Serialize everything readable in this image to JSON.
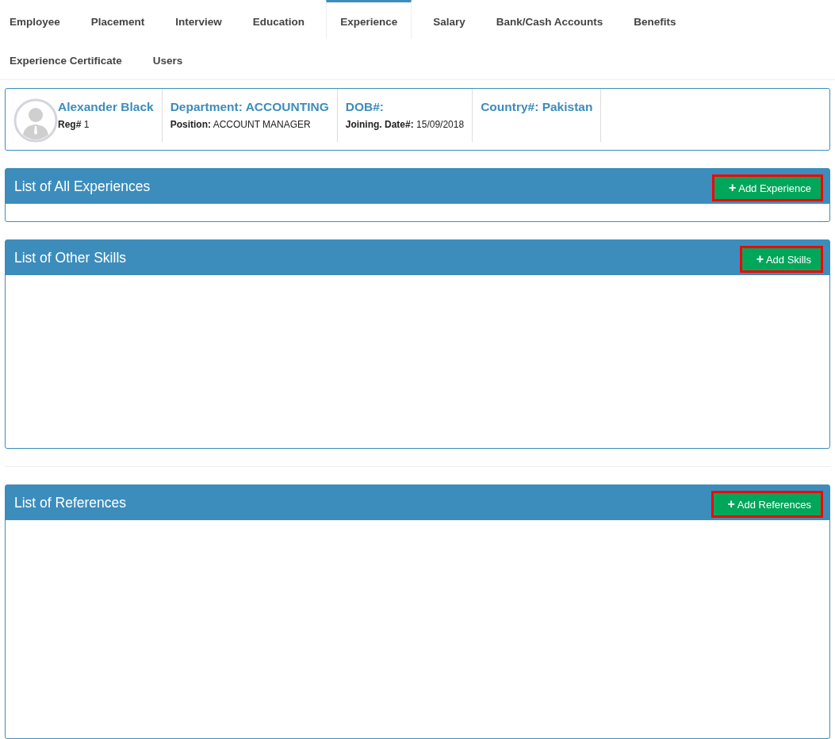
{
  "tabs": [
    {
      "label": "Employee",
      "selected": false
    },
    {
      "label": "Placement",
      "selected": false
    },
    {
      "label": "Interview",
      "selected": false
    },
    {
      "label": "Education",
      "selected": false
    },
    {
      "label": "Experience",
      "selected": true
    },
    {
      "label": "Salary",
      "selected": false
    },
    {
      "label": "Bank/Cash Accounts",
      "selected": false
    },
    {
      "label": "Benefits",
      "selected": false
    },
    {
      "label": "Experience Certificate",
      "selected": false
    },
    {
      "label": "Users",
      "selected": false
    }
  ],
  "profile": {
    "name": "Alexander Black",
    "reg_label": "Reg#",
    "reg": "1",
    "department": "Department: ACCOUNTING",
    "position_label": "Position:",
    "position": "ACCOUNT MANAGER",
    "dob": "DOB#:",
    "joining_label": "Joining. Date#:",
    "joining": "15/09/2018",
    "country": "Country#: Pakistan"
  },
  "panels": [
    {
      "title": "List of All Experiences",
      "button": {
        "label": "Add Experience",
        "icon": "+",
        "highlighted": true
      }
    },
    {
      "title": "List of Other Skills",
      "button": {
        "label": "Add Skills",
        "icon": "+",
        "highlighted": true
      }
    },
    {
      "title": "List of References",
      "button": {
        "label": "Add References",
        "icon": "+",
        "highlighted": true
      }
    }
  ]
}
